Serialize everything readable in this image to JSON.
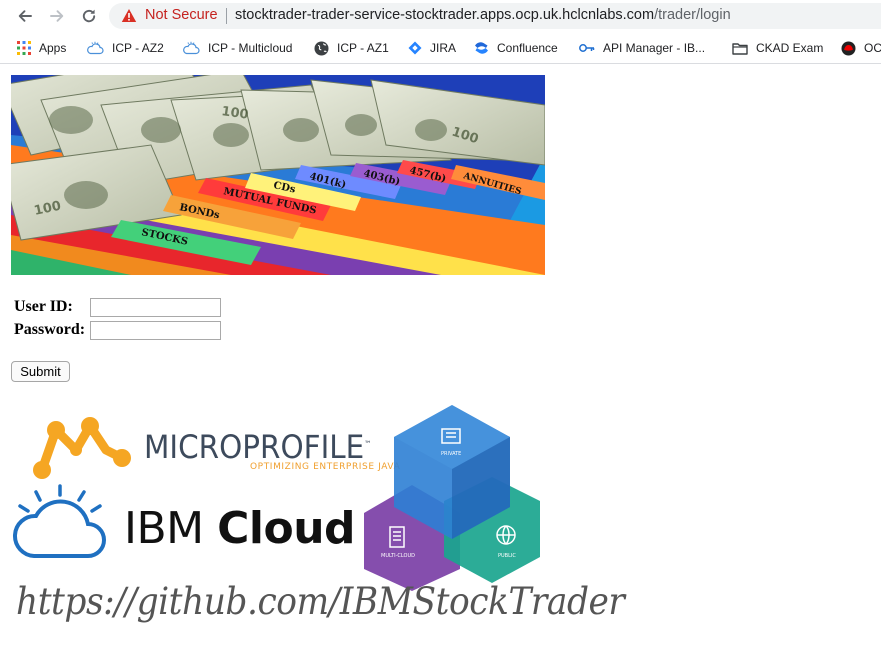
{
  "browser": {
    "security_label": "Not Secure",
    "url_host": "stocktrader-trader-service-stocktrader.apps.ocp.uk.hclcnlabs.com",
    "url_path": "/trader/login"
  },
  "bookmarks": [
    {
      "label": "Apps",
      "icon": "apps-grid-icon"
    },
    {
      "label": "ICP - AZ2",
      "icon": "cloud-icon"
    },
    {
      "label": "ICP - Multicloud",
      "icon": "cloud-icon"
    },
    {
      "label": "ICP - AZ1",
      "icon": "globe-icon"
    },
    {
      "label": "JIRA",
      "icon": "jira-icon"
    },
    {
      "label": "Confluence",
      "icon": "confluence-icon"
    },
    {
      "label": "API Manager - IB...",
      "icon": "key-icon"
    },
    {
      "label": "CKAD Exam",
      "icon": "folder-icon"
    },
    {
      "label": "OC",
      "icon": "redhat-icon"
    }
  ],
  "banner": {
    "tabs": [
      "STOCKS",
      "BONDs",
      "MUTUAL FUNDS",
      "CDs",
      "401(k)",
      "403(b)",
      "457(b)",
      "ANNUITIES"
    ],
    "colors": {
      "stocks": "#2fb36a",
      "bonds": "#f18a1e",
      "mutual": "#e8262c",
      "cds": "#ffe14a",
      "k401": "#4a69d8",
      "b403": "#7a3fb0",
      "b457": "#e8262c",
      "annuities": "#ff6a1e"
    }
  },
  "login": {
    "user_label": "User ID:",
    "password_label": "Password:",
    "user_value": "",
    "password_value": "",
    "submit_label": "Submit"
  },
  "logos": {
    "microprofile_text": "MICROPROFILE",
    "microprofile_tm": "™",
    "microprofile_tagline": "OPTIMIZING ENTERPRISE JAVA",
    "ibm_prefix": "IBM ",
    "ibm_bold": "Cloud",
    "cube_private": "PRIVATE",
    "cube_multicloud": "MULTI-CLOUD",
    "cube_public": "PUBLIC",
    "github_url": "https://github.com/IBMStockTrader"
  }
}
